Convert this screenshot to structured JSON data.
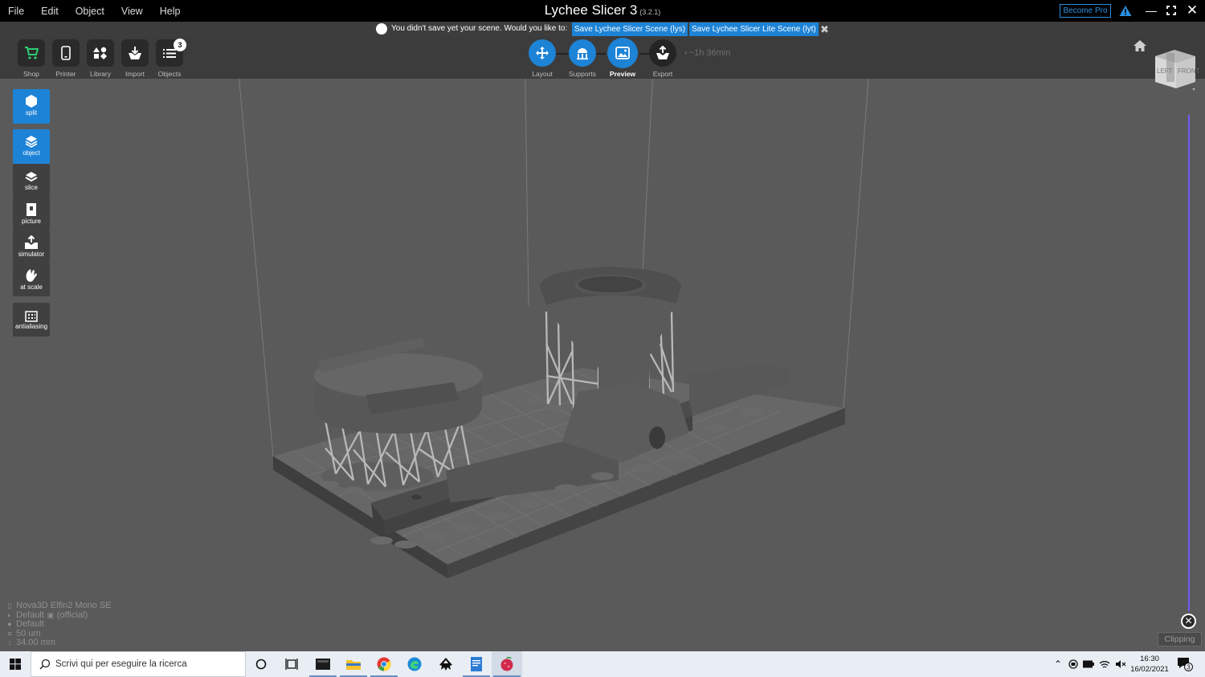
{
  "menu": [
    "File",
    "Edit",
    "Object",
    "View",
    "Help"
  ],
  "app": {
    "title": "Lychee Slicer 3",
    "version": "(3.2.1)",
    "become_pro": "Become Pro"
  },
  "notification": {
    "text": "You didn't save yet your scene. Would you like to:",
    "button1": "Save Lychee Slicer Scene (lys)",
    "button2": "Save Lychee Slicer Lite Scene (lyt)"
  },
  "toolbar": {
    "shop": "Shop",
    "printer": "Printer",
    "library": "Library",
    "import": "Import",
    "objects": "Objects",
    "objects_badge": "3"
  },
  "workflow": {
    "layout": "Layout",
    "supports": "Supports",
    "preview": "Preview",
    "export": "Export",
    "print_time": "~1h 36min",
    "active": "preview"
  },
  "viewcube": {
    "left": "LEFT",
    "front": "FRONT"
  },
  "sidebar": {
    "split": "split",
    "object": "object",
    "slice": "slice",
    "picture": "picture",
    "simulator": "simulator",
    "at_scale": "at scale",
    "antialiasing": "antialiasing"
  },
  "printer_info": {
    "printer": "Nova3D Elfin2 Mono SE",
    "profile": "Default",
    "profile_tag": "(official)",
    "resin": "Default",
    "layer_height": "50 um",
    "height": "34.00 mm"
  },
  "clipping": {
    "label": "Clipping"
  },
  "taskbar": {
    "search_placeholder": "Scrivi qui per eseguire la ricerca",
    "time": "16:30",
    "date": "16/02/2021",
    "notifications": "3"
  },
  "colors": {
    "accent": "#1d83d6",
    "clip": "#6b5cf6",
    "viewport": "#5a5a5a"
  }
}
